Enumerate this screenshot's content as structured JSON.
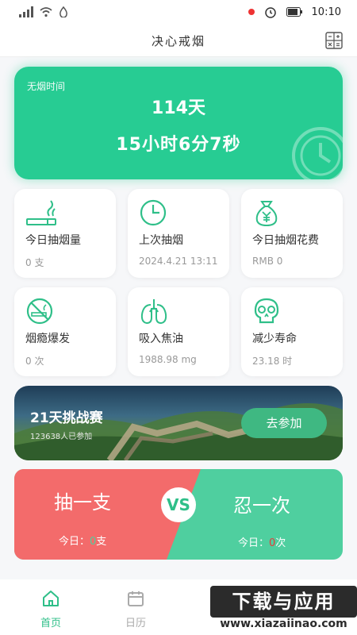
{
  "status": {
    "time": "10:10"
  },
  "header": {
    "title": "决心戒烟",
    "calc_icon": "calculator-icon"
  },
  "hero": {
    "label": "无烟时间",
    "days": "114天",
    "time": "15小时6分7秒",
    "icon": "clock-icon"
  },
  "stats": [
    {
      "name": "今日抽烟量",
      "value": "0 支",
      "icon": "cigarette-icon"
    },
    {
      "name": "上次抽烟",
      "value": "2024.4.21 13:11",
      "icon": "clock-icon"
    },
    {
      "name": "今日抽烟花费",
      "value": "RMB 0",
      "icon": "money-bag-icon"
    },
    {
      "name": "烟瘾爆发",
      "value": "0 次",
      "icon": "no-smoking-icon"
    },
    {
      "name": "吸入焦油",
      "value": "1988.98 mg",
      "icon": "lungs-icon"
    },
    {
      "name": "减少寿命",
      "value": "23.18 时",
      "icon": "skull-icon"
    }
  ],
  "challenge": {
    "title": "21天挑战赛",
    "participants": "123638人已参加",
    "button": "去参加"
  },
  "versus": {
    "smoke_label": "抽一支",
    "endure_label": "忍一次",
    "vs": "VS",
    "today_prefix": "今日：",
    "smoke_count": "0",
    "smoke_unit": "支",
    "endure_count": "0",
    "endure_unit": "次"
  },
  "tabs": [
    {
      "label": "首页",
      "icon": "home-icon",
      "active": true
    },
    {
      "label": "日历",
      "icon": "calendar-icon",
      "active": false
    }
  ],
  "watermark": {
    "title": "下载与应用",
    "url": "www.xiazaiinao.com"
  },
  "colors": {
    "accent": "#27cc93",
    "red": "#f36b6b",
    "green": "#4fcf9f"
  }
}
